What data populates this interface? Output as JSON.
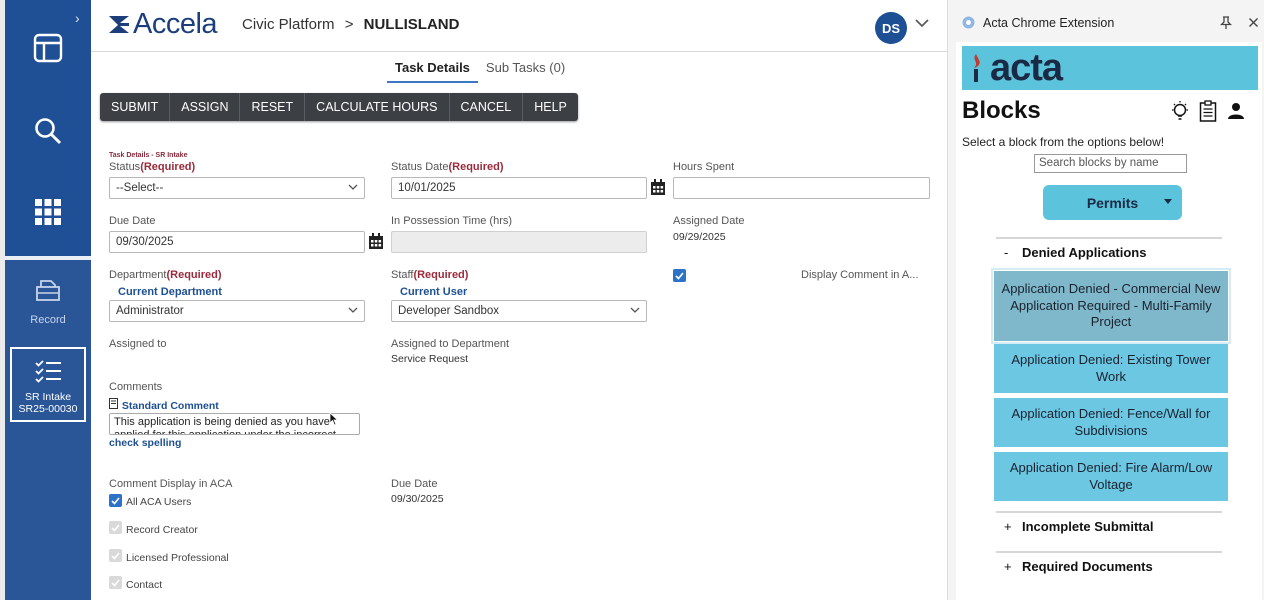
{
  "app": {
    "brand": "Accela",
    "breadcrumb_platform": "Civic Platform",
    "breadcrumb_sep": ">",
    "breadcrumb_agency": "NULLISLAND",
    "avatar_initials": "DS",
    "colors": {
      "brand_blue": "#1c3f7c",
      "rail_blue": "#2a5698",
      "accent": "#3b77c4",
      "required": "#9b2a3a"
    }
  },
  "rail": {
    "items": [
      {
        "icon": "dashboard-icon"
      },
      {
        "icon": "search-icon"
      },
      {
        "icon": "apps-grid-icon"
      },
      {
        "icon": "record-icon",
        "label": "Record"
      }
    ],
    "active": {
      "icon": "task-list-icon",
      "line1": "SR Intake",
      "line2": "SR25-00030"
    }
  },
  "tabs": [
    {
      "label": "Task Details",
      "active": true
    },
    {
      "label": "Sub Tasks (0)",
      "active": false
    }
  ],
  "toolbar": [
    "SUBMIT",
    "ASSIGN",
    "RESET",
    "CALCULATE HOURS",
    "CANCEL",
    "HELP"
  ],
  "form": {
    "section_caption": "Task Details - SR Intake",
    "status_label": "Status",
    "required_tag": "(Required)",
    "status_value": "--Select--",
    "status_date_label": "Status Date",
    "status_date_value": "10/01/2025",
    "hours_spent_label": "Hours Spent",
    "hours_spent_value": "",
    "due_date_label": "Due Date",
    "due_date_value": "09/30/2025",
    "possession_label": "In Possession Time (hrs)",
    "possession_value": "",
    "assigned_date_label": "Assigned Date",
    "assigned_date_value": "09/29/2025",
    "department_label": "Department",
    "current_department_link": "Current Department",
    "department_value": "Administrator",
    "staff_label": "Staff",
    "current_user_link": "Current User",
    "staff_value": "Developer Sandbox",
    "display_comment_label": "Display Comment in A...",
    "assigned_to_label": "Assigned to",
    "assigned_to_dept_label": "Assigned to Department",
    "assigned_to_dept_value": "Service Request",
    "comments_label": "Comments",
    "standard_comment_link": "Standard Comment",
    "comment_text": "This application is being denied as you have applied for this application under the incorrect",
    "check_spelling": "check spelling",
    "comment_display_label": "Comment Display in ACA",
    "aca_options": [
      {
        "label": "All ACA Users",
        "checked": true,
        "enabled": true
      },
      {
        "label": "Record Creator",
        "checked": true,
        "enabled": false
      },
      {
        "label": "Licensed Professional",
        "checked": true,
        "enabled": false
      },
      {
        "label": "Contact",
        "checked": true,
        "enabled": false
      }
    ],
    "due_date2_label": "Due Date",
    "due_date2_value": "09/30/2025"
  },
  "extension": {
    "title": "Acta Chrome Extension",
    "brand": "acta",
    "blocks_title": "Blocks",
    "instruction": "Select a block from the options below!",
    "search_placeholder": "Search blocks by name",
    "category": "Permits",
    "sections": [
      {
        "label": "Denied Applications",
        "expanded": true,
        "sign": "-"
      },
      {
        "label": "Incomplete Submittal",
        "expanded": false,
        "sign": "+"
      },
      {
        "label": "Required Documents",
        "expanded": false,
        "sign": "+"
      }
    ],
    "blocks": [
      "Application Denied - Commercial New Application Required - Multi-Family Project",
      "Application Denied: Existing Tower Work",
      "Application Denied: Fence/Wall for Subdivisions",
      "Application Denied: Fire Alarm/Low Voltage"
    ],
    "colors": {
      "banner": "#5cc3dd",
      "block": "#6cc7e2"
    }
  }
}
